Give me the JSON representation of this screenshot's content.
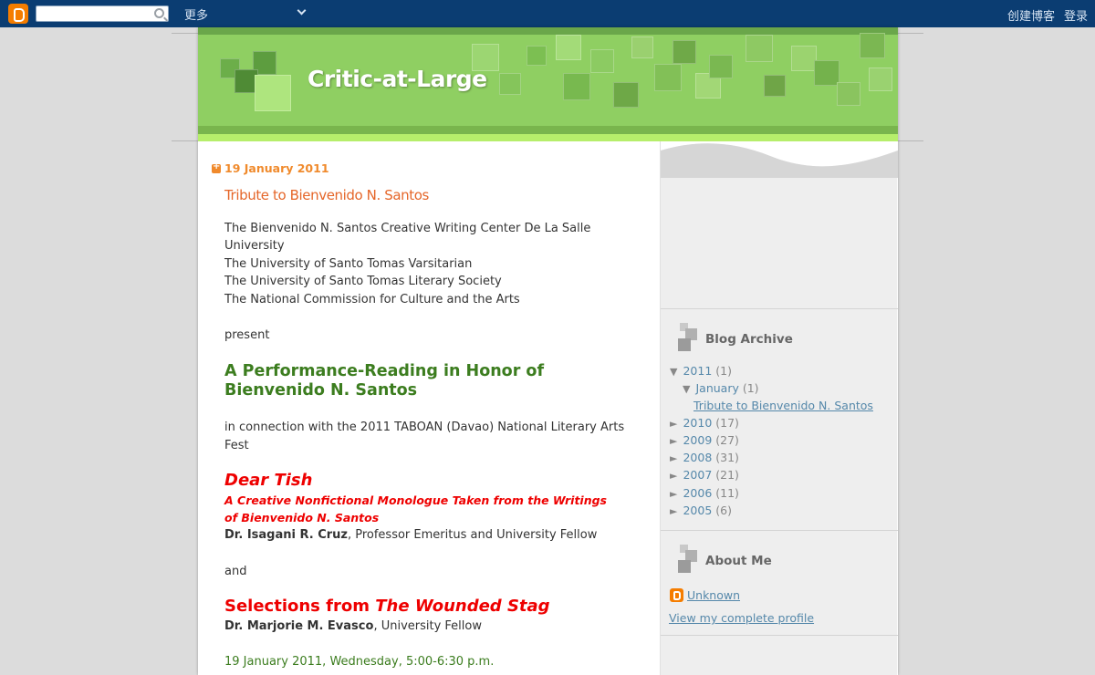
{
  "navbar": {
    "more_label": "更多",
    "create_blog": "创建博客",
    "login": "登录",
    "search_value": ""
  },
  "blog": {
    "title": "Critic-at-Large"
  },
  "post": {
    "date": "19 January 2011",
    "title": "Tribute to Bienvenido N. Santos",
    "presenters": [
      "The Bienvenido N. Santos Creative Writing Center De La Salle",
      "University",
      "The University of Santo Tomas Varsitarian",
      "The University of Santo Tomas Literary Society",
      "The National Commission for Culture and the Arts"
    ],
    "present": "present",
    "headline_1": "A Performance-Reading in Honor of",
    "headline_2": "Bienvenido N. Santos",
    "connection_1": "in connection with the 2011 TABOAN (Davao) National Literary Arts",
    "connection_2": "Fest",
    "piece1_title": "Dear Tish",
    "piece1_sub_1": "A Creative Nonfictional Monologue Taken from the Writings",
    "piece1_sub_2": "of Bienvenido N. Santos",
    "piece1_author": "Dr. Isagani R. Cruz",
    "piece1_author_role": ", Professor Emeritus and University Fellow",
    "and": "and",
    "piece2_prefix": "Selections from ",
    "piece2_title": "The Wounded Stag",
    "piece2_author": "Dr. Marjorie M. Evasco",
    "piece2_author_role": ", University Fellow",
    "event_date": "19 January 2011, Wednesday, 5:00-6:30 p.m."
  },
  "sidebar": {
    "archive_title": "Blog Archive",
    "years": [
      {
        "year": "2011",
        "count": "(1)",
        "expanded": true
      },
      {
        "year": "2010",
        "count": "(17)"
      },
      {
        "year": "2009",
        "count": "(27)"
      },
      {
        "year": "2008",
        "count": "(31)"
      },
      {
        "year": "2007",
        "count": "(21)"
      },
      {
        "year": "2006",
        "count": "(11)"
      },
      {
        "year": "2005",
        "count": "(6)"
      }
    ],
    "month": {
      "name": "January",
      "count": "(1)"
    },
    "month_post": "Tribute to Bienvenido N. Santos",
    "about_title": "About Me",
    "profile_name": "Unknown",
    "profile_link": "View my complete profile"
  },
  "colors": {
    "navbar_bg": "#0b3d72",
    "header_green": "#8fcf62",
    "date_orange": "#f08a2c",
    "title_orange": "#e56629",
    "headline_green": "#3c7d1f",
    "accent_red": "#e00000",
    "link_blue": "#5588aa"
  }
}
